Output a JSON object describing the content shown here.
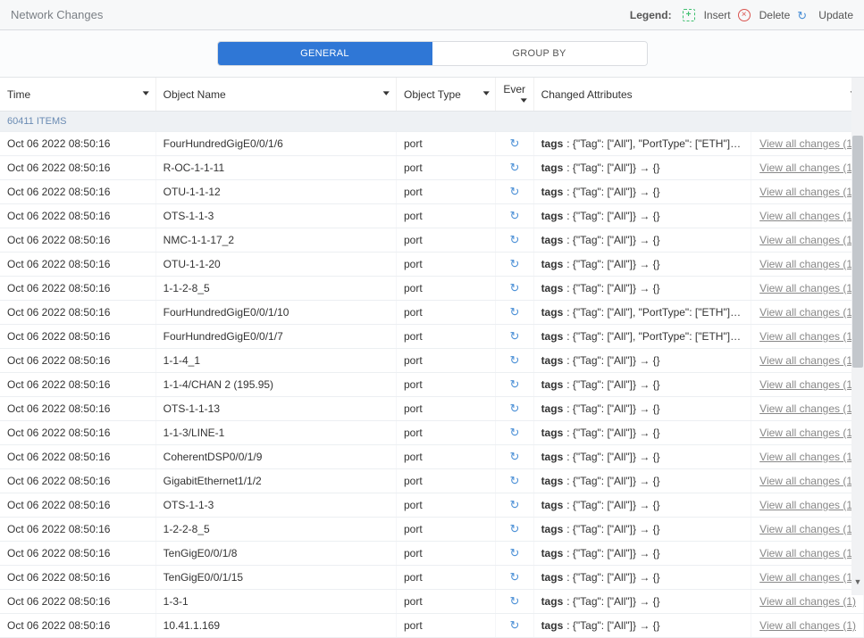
{
  "header": {
    "title": "Network Changes"
  },
  "legend": {
    "label": "Legend:",
    "insert": "Insert",
    "delete": "Delete",
    "update": "Update"
  },
  "tabs": {
    "general": "GENERAL",
    "groupby": "GROUP BY"
  },
  "columns": {
    "time": "Time",
    "name": "Object Name",
    "type": "Object Type",
    "event": "Ever",
    "attr": "Changed Attributes"
  },
  "count": "60411 ITEMS",
  "view_label": "View all changes (1)",
  "tags_label": "tags",
  "attr_simple": ": {\"Tag\": [\"All\"]} → {}",
  "attr_porttype": ": {\"Tag\": [\"All\"], \"PortType\": [\"ETH\"]} → {\"PortType\": [\"ETH\"",
  "rows": [
    {
      "time": "Oct 06 2022 08:50:16",
      "name": "FourHundredGigE0/0/1/6",
      "type": "port",
      "attr": "port"
    },
    {
      "time": "Oct 06 2022 08:50:16",
      "name": "R-OC-1-1-11",
      "type": "port",
      "attr": "simple"
    },
    {
      "time": "Oct 06 2022 08:50:16",
      "name": "OTU-1-1-12",
      "type": "port",
      "attr": "simple"
    },
    {
      "time": "Oct 06 2022 08:50:16",
      "name": "OTS-1-1-3",
      "type": "port",
      "attr": "simple"
    },
    {
      "time": "Oct 06 2022 08:50:16",
      "name": "NMC-1-1-17_2",
      "type": "port",
      "attr": "simple"
    },
    {
      "time": "Oct 06 2022 08:50:16",
      "name": "OTU-1-1-20",
      "type": "port",
      "attr": "simple"
    },
    {
      "time": "Oct 06 2022 08:50:16",
      "name": "1-1-2-8_5",
      "type": "port",
      "attr": "simple"
    },
    {
      "time": "Oct 06 2022 08:50:16",
      "name": "FourHundredGigE0/0/1/10",
      "type": "port",
      "attr": "port"
    },
    {
      "time": "Oct 06 2022 08:50:16",
      "name": "FourHundredGigE0/0/1/7",
      "type": "port",
      "attr": "port"
    },
    {
      "time": "Oct 06 2022 08:50:16",
      "name": "1-1-4_1",
      "type": "port",
      "attr": "simple"
    },
    {
      "time": "Oct 06 2022 08:50:16",
      "name": "1-1-4/CHAN 2 (195.95)",
      "type": "port",
      "attr": "simple"
    },
    {
      "time": "Oct 06 2022 08:50:16",
      "name": "OTS-1-1-13",
      "type": "port",
      "attr": "simple"
    },
    {
      "time": "Oct 06 2022 08:50:16",
      "name": "1-1-3/LINE-1",
      "type": "port",
      "attr": "simple"
    },
    {
      "time": "Oct 06 2022 08:50:16",
      "name": "CoherentDSP0/0/1/9",
      "type": "port",
      "attr": "simple"
    },
    {
      "time": "Oct 06 2022 08:50:16",
      "name": "GigabitEthernet1/1/2",
      "type": "port",
      "attr": "simple"
    },
    {
      "time": "Oct 06 2022 08:50:16",
      "name": "OTS-1-1-3",
      "type": "port",
      "attr": "simple"
    },
    {
      "time": "Oct 06 2022 08:50:16",
      "name": "1-2-2-8_5",
      "type": "port",
      "attr": "simple"
    },
    {
      "time": "Oct 06 2022 08:50:16",
      "name": "TenGigE0/0/1/8",
      "type": "port",
      "attr": "simple"
    },
    {
      "time": "Oct 06 2022 08:50:16",
      "name": "TenGigE0/0/1/15",
      "type": "port",
      "attr": "simple"
    },
    {
      "time": "Oct 06 2022 08:50:16",
      "name": "1-3-1",
      "type": "port",
      "attr": "simple"
    },
    {
      "time": "Oct 06 2022 08:50:16",
      "name": "10.41.1.169",
      "type": "port",
      "attr": "simple"
    }
  ]
}
